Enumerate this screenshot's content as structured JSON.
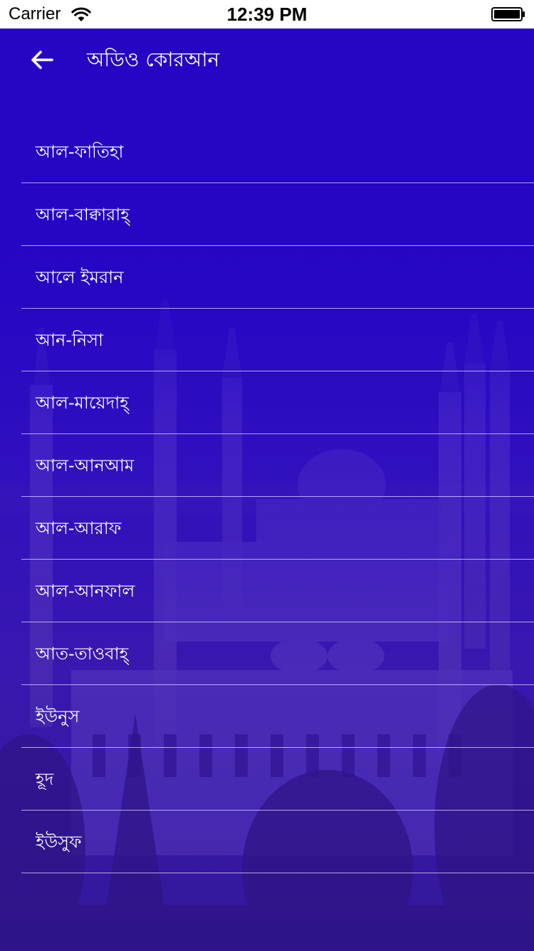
{
  "status_bar": {
    "carrier": "Carrier",
    "time": "12:39 PM",
    "icons": [
      "wifi-icon",
      "battery-icon"
    ]
  },
  "nav": {
    "back_icon": "arrow-left-icon",
    "title": "অডিও কোরআন"
  },
  "surahs": [
    {
      "label": "আল-ফাতিহা"
    },
    {
      "label": "আল-বাক্বারাহ্"
    },
    {
      "label": "আলে ইমরান"
    },
    {
      "label": "আন-নিসা"
    },
    {
      "label": "আল-মায়েদাহ্"
    },
    {
      "label": "আল-আনআম"
    },
    {
      "label": "আল-আরাফ"
    },
    {
      "label": "আল-আনফাল"
    },
    {
      "label": "আত-তাওবাহ্"
    },
    {
      "label": "ইউনুস"
    },
    {
      "label": "হূদ"
    },
    {
      "label": "ইউসুফ"
    }
  ],
  "colors": {
    "header_bg": "#2606c4",
    "text": "#ffffff",
    "divider": "#dcd7ff"
  }
}
